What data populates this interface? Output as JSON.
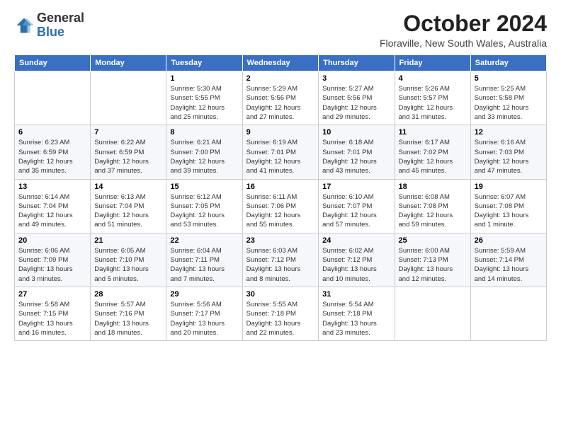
{
  "header": {
    "logo_general": "General",
    "logo_blue": "Blue",
    "month": "October 2024",
    "location": "Floraville, New South Wales, Australia"
  },
  "weekdays": [
    "Sunday",
    "Monday",
    "Tuesday",
    "Wednesday",
    "Thursday",
    "Friday",
    "Saturday"
  ],
  "weeks": [
    [
      {
        "day": "",
        "info": ""
      },
      {
        "day": "",
        "info": ""
      },
      {
        "day": "1",
        "info": "Sunrise: 5:30 AM\nSunset: 5:55 PM\nDaylight: 12 hours\nand 25 minutes."
      },
      {
        "day": "2",
        "info": "Sunrise: 5:29 AM\nSunset: 5:56 PM\nDaylight: 12 hours\nand 27 minutes."
      },
      {
        "day": "3",
        "info": "Sunrise: 5:27 AM\nSunset: 5:56 PM\nDaylight: 12 hours\nand 29 minutes."
      },
      {
        "day": "4",
        "info": "Sunrise: 5:26 AM\nSunset: 5:57 PM\nDaylight: 12 hours\nand 31 minutes."
      },
      {
        "day": "5",
        "info": "Sunrise: 5:25 AM\nSunset: 5:58 PM\nDaylight: 12 hours\nand 33 minutes."
      }
    ],
    [
      {
        "day": "6",
        "info": "Sunrise: 6:23 AM\nSunset: 6:59 PM\nDaylight: 12 hours\nand 35 minutes."
      },
      {
        "day": "7",
        "info": "Sunrise: 6:22 AM\nSunset: 6:59 PM\nDaylight: 12 hours\nand 37 minutes."
      },
      {
        "day": "8",
        "info": "Sunrise: 6:21 AM\nSunset: 7:00 PM\nDaylight: 12 hours\nand 39 minutes."
      },
      {
        "day": "9",
        "info": "Sunrise: 6:19 AM\nSunset: 7:01 PM\nDaylight: 12 hours\nand 41 minutes."
      },
      {
        "day": "10",
        "info": "Sunrise: 6:18 AM\nSunset: 7:01 PM\nDaylight: 12 hours\nand 43 minutes."
      },
      {
        "day": "11",
        "info": "Sunrise: 6:17 AM\nSunset: 7:02 PM\nDaylight: 12 hours\nand 45 minutes."
      },
      {
        "day": "12",
        "info": "Sunrise: 6:16 AM\nSunset: 7:03 PM\nDaylight: 12 hours\nand 47 minutes."
      }
    ],
    [
      {
        "day": "13",
        "info": "Sunrise: 6:14 AM\nSunset: 7:04 PM\nDaylight: 12 hours\nand 49 minutes."
      },
      {
        "day": "14",
        "info": "Sunrise: 6:13 AM\nSunset: 7:04 PM\nDaylight: 12 hours\nand 51 minutes."
      },
      {
        "day": "15",
        "info": "Sunrise: 6:12 AM\nSunset: 7:05 PM\nDaylight: 12 hours\nand 53 minutes."
      },
      {
        "day": "16",
        "info": "Sunrise: 6:11 AM\nSunset: 7:06 PM\nDaylight: 12 hours\nand 55 minutes."
      },
      {
        "day": "17",
        "info": "Sunrise: 6:10 AM\nSunset: 7:07 PM\nDaylight: 12 hours\nand 57 minutes."
      },
      {
        "day": "18",
        "info": "Sunrise: 6:08 AM\nSunset: 7:08 PM\nDaylight: 12 hours\nand 59 minutes."
      },
      {
        "day": "19",
        "info": "Sunrise: 6:07 AM\nSunset: 7:08 PM\nDaylight: 13 hours\nand 1 minute."
      }
    ],
    [
      {
        "day": "20",
        "info": "Sunrise: 6:06 AM\nSunset: 7:09 PM\nDaylight: 13 hours\nand 3 minutes."
      },
      {
        "day": "21",
        "info": "Sunrise: 6:05 AM\nSunset: 7:10 PM\nDaylight: 13 hours\nand 5 minutes."
      },
      {
        "day": "22",
        "info": "Sunrise: 6:04 AM\nSunset: 7:11 PM\nDaylight: 13 hours\nand 7 minutes."
      },
      {
        "day": "23",
        "info": "Sunrise: 6:03 AM\nSunset: 7:12 PM\nDaylight: 13 hours\nand 8 minutes."
      },
      {
        "day": "24",
        "info": "Sunrise: 6:02 AM\nSunset: 7:12 PM\nDaylight: 13 hours\nand 10 minutes."
      },
      {
        "day": "25",
        "info": "Sunrise: 6:00 AM\nSunset: 7:13 PM\nDaylight: 13 hours\nand 12 minutes."
      },
      {
        "day": "26",
        "info": "Sunrise: 5:59 AM\nSunset: 7:14 PM\nDaylight: 13 hours\nand 14 minutes."
      }
    ],
    [
      {
        "day": "27",
        "info": "Sunrise: 5:58 AM\nSunset: 7:15 PM\nDaylight: 13 hours\nand 16 minutes."
      },
      {
        "day": "28",
        "info": "Sunrise: 5:57 AM\nSunset: 7:16 PM\nDaylight: 13 hours\nand 18 minutes."
      },
      {
        "day": "29",
        "info": "Sunrise: 5:56 AM\nSunset: 7:17 PM\nDaylight: 13 hours\nand 20 minutes."
      },
      {
        "day": "30",
        "info": "Sunrise: 5:55 AM\nSunset: 7:18 PM\nDaylight: 13 hours\nand 22 minutes."
      },
      {
        "day": "31",
        "info": "Sunrise: 5:54 AM\nSunset: 7:18 PM\nDaylight: 13 hours\nand 23 minutes."
      },
      {
        "day": "",
        "info": ""
      },
      {
        "day": "",
        "info": ""
      }
    ]
  ]
}
